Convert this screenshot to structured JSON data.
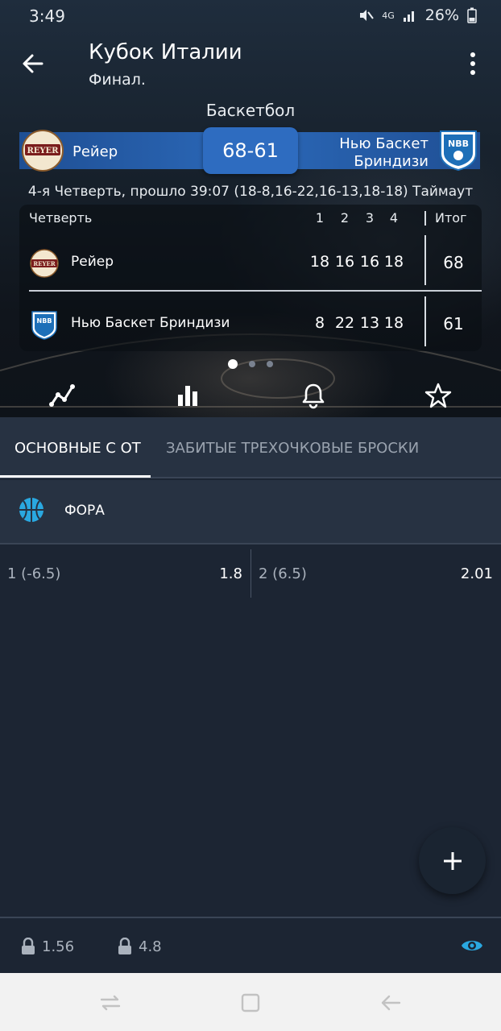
{
  "status_bar": {
    "time": "3:49",
    "network": "4G",
    "battery": "26%"
  },
  "header": {
    "title": "Кубок Италии",
    "subtitle": "Финал.",
    "sport": "Баскетбол"
  },
  "match": {
    "home_team": "Рейер",
    "away_team_line1": "Нью Баскет",
    "away_team_line2": "Бриндизи",
    "score": "68-61",
    "status": "4-я Четверть, прошло 39:07 (18-8,16-22,16-13,18-18) Таймаут"
  },
  "score_table": {
    "quarter_label": "Четверть",
    "columns": [
      "1",
      "2",
      "3",
      "4"
    ],
    "total_label": "Итог",
    "rows": [
      {
        "team": "Рейер",
        "scores": [
          "18",
          "16",
          "16",
          "18"
        ],
        "total": "68"
      },
      {
        "team": "Нью Баскет Бриндизи",
        "scores": [
          "8",
          "22",
          "13",
          "18"
        ],
        "total": "61"
      }
    ]
  },
  "tabs": [
    {
      "label": "ОСНОВНЫЕ С ОТ",
      "active": true
    },
    {
      "label": "ЗАБИТЫЕ ТРЕХОЧКОВЫЕ БРОСКИ",
      "active": false
    }
  ],
  "market": {
    "title": "ФОРА",
    "icon": "basketball-icon",
    "odds": [
      {
        "label": "1 (-6.5)",
        "value": "1.8"
      },
      {
        "label": "2 (6.5)",
        "value": "2.01"
      }
    ]
  },
  "bottom_bar": {
    "lock_1": "1.56",
    "lock_2": "4.8"
  },
  "colors": {
    "accent_blue": "#2e6cc0",
    "eye_icon": "#2aa8e0",
    "panel": "#273242",
    "background": "#1c2533"
  }
}
